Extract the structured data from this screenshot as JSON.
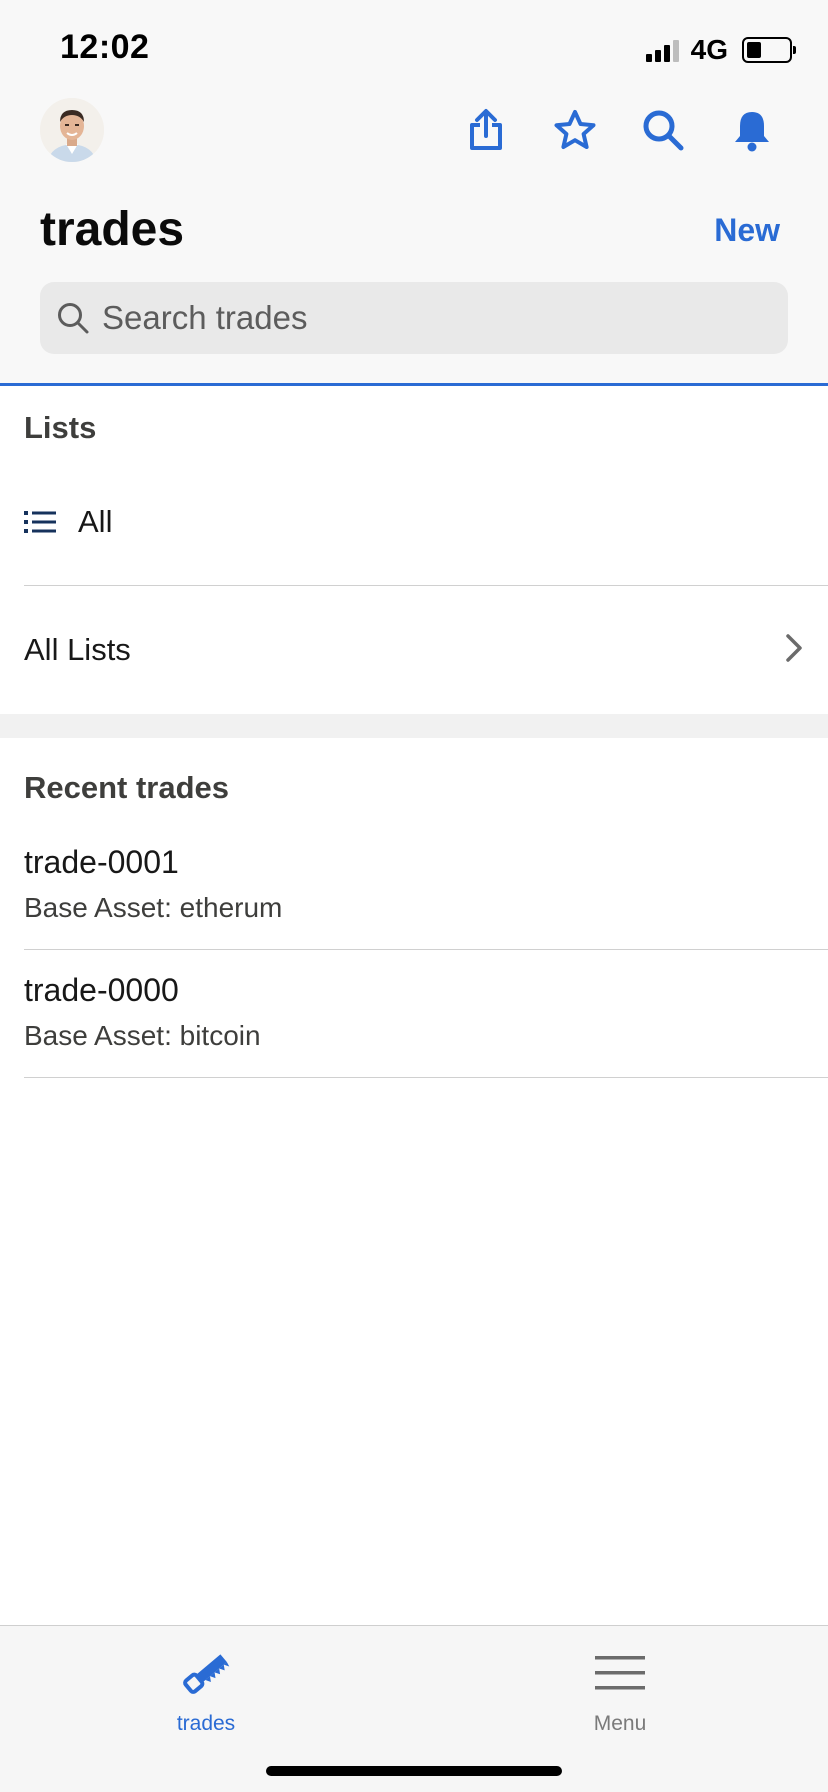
{
  "status_bar": {
    "time": "12:02",
    "network": "4G",
    "signal_bars": 3,
    "signal_bars_total": 4,
    "battery_level": 0.35
  },
  "header": {
    "title": "trades",
    "new_label": "New",
    "search_placeholder": "Search trades",
    "icons": [
      "avatar",
      "share-icon",
      "star-icon",
      "search-icon",
      "bell-icon"
    ],
    "accent_color": "#2a6bd4"
  },
  "lists": {
    "heading": "Lists",
    "items": [
      {
        "label": "All",
        "icon": "list-icon"
      },
      {
        "label": "All Lists",
        "icon": "chevron-right-icon"
      }
    ]
  },
  "recent": {
    "heading": "Recent trades",
    "records": [
      {
        "title": "trade-0001",
        "subtitle": "Base Asset: etherum"
      },
      {
        "title": "trade-0000",
        "subtitle": "Base Asset: bitcoin"
      }
    ]
  },
  "tabbar": {
    "tabs": [
      {
        "label": "trades",
        "icon": "saw-icon",
        "active": true,
        "color": "#2a6bd4"
      },
      {
        "label": "Menu",
        "icon": "hamburger-icon",
        "active": false,
        "color": "#7a7a7a"
      }
    ]
  }
}
